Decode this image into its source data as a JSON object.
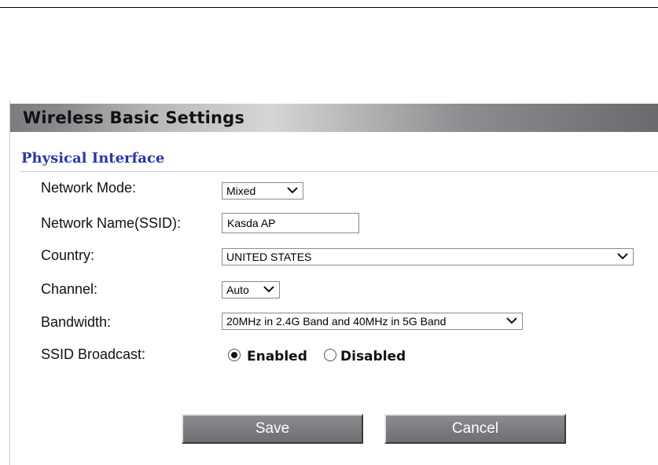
{
  "page": {
    "title": "Wireless Basic Settings",
    "section_title": "Physical Interface"
  },
  "form": {
    "network_mode": {
      "label": "Network Mode:",
      "value": "Mixed"
    },
    "ssid": {
      "label": "Network Name(SSID):",
      "value": "Kasda AP"
    },
    "country": {
      "label": "Country:",
      "value": "UNITED STATES"
    },
    "channel": {
      "label": "Channel:",
      "value": "Auto"
    },
    "bandwidth": {
      "label": "Bandwidth:",
      "value": "20MHz in 2.4G Band and 40MHz in 5G Band"
    },
    "ssid_broadcast": {
      "label": "SSID Broadcast:",
      "enabled_label": "Enabled",
      "disabled_label": "Disabled",
      "selected": "Enabled"
    }
  },
  "buttons": {
    "save": "Save",
    "cancel": "Cancel"
  },
  "colors": {
    "section_title": "#2638a8",
    "button_face": "#7a7a7e",
    "panel_border": "#b9d4b3"
  },
  "icons": {
    "dropdown": "chevron-down-icon",
    "radio_checked": "radio-checked-icon",
    "radio_unchecked": "radio-unchecked-icon"
  }
}
